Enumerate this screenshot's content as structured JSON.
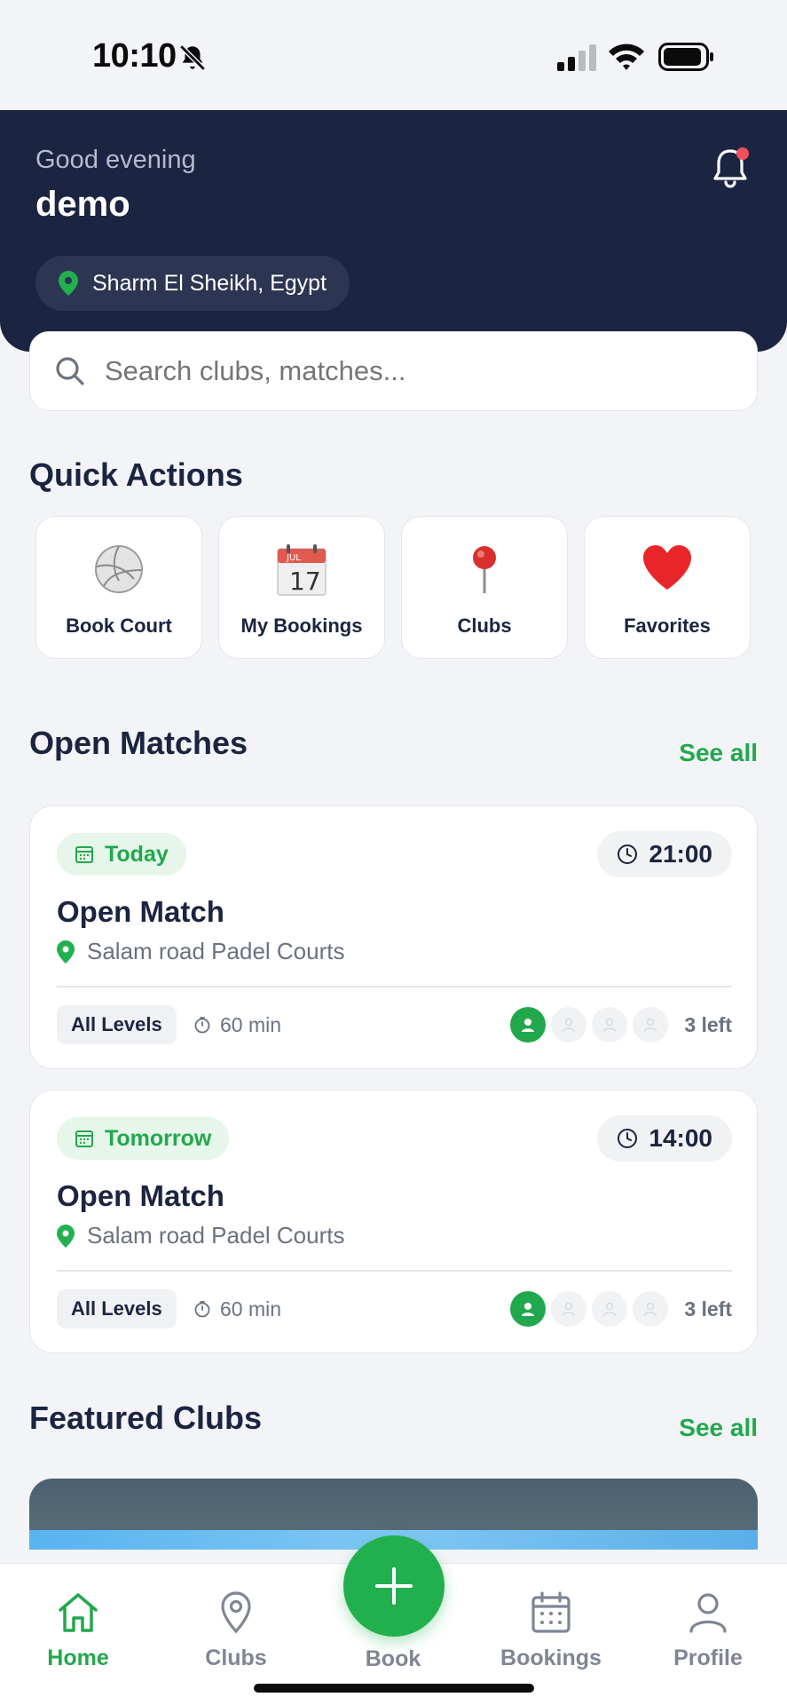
{
  "status_bar": {
    "time": "10:10"
  },
  "header": {
    "greeting": "Good evening",
    "username": "demo",
    "location": "Sharm El Sheikh, Egypt"
  },
  "search": {
    "placeholder": "Search clubs, matches..."
  },
  "quick_actions": {
    "title": "Quick Actions",
    "items": [
      {
        "label": "Book Court",
        "icon": "volleyball-icon"
      },
      {
        "label": "My Bookings",
        "icon": "calendar-icon"
      },
      {
        "label": "Clubs",
        "icon": "pin-icon"
      },
      {
        "label": "Favorites",
        "icon": "heart-icon"
      }
    ]
  },
  "open_matches": {
    "title": "Open Matches",
    "see_all": "See all",
    "matches": [
      {
        "day": "Today",
        "time": "21:00",
        "title": "Open Match",
        "venue": "Salam road Padel Courts",
        "level": "All Levels",
        "duration": "60 min",
        "spots_left": "3 left"
      },
      {
        "day": "Tomorrow",
        "time": "14:00",
        "title": "Open Match",
        "venue": "Salam road Padel Courts",
        "level": "All Levels",
        "duration": "60 min",
        "spots_left": "3 left"
      }
    ]
  },
  "featured_clubs": {
    "title": "Featured Clubs",
    "see_all": "See all"
  },
  "bottom_nav": {
    "items": [
      {
        "label": "Home"
      },
      {
        "label": "Clubs"
      },
      {
        "label": "Book"
      },
      {
        "label": "Bookings"
      },
      {
        "label": "Profile"
      }
    ]
  },
  "colors": {
    "navy": "#1b2440",
    "accent_green": "#22a84c",
    "notification_red": "#f0505a",
    "background": "#f3f4f7"
  }
}
